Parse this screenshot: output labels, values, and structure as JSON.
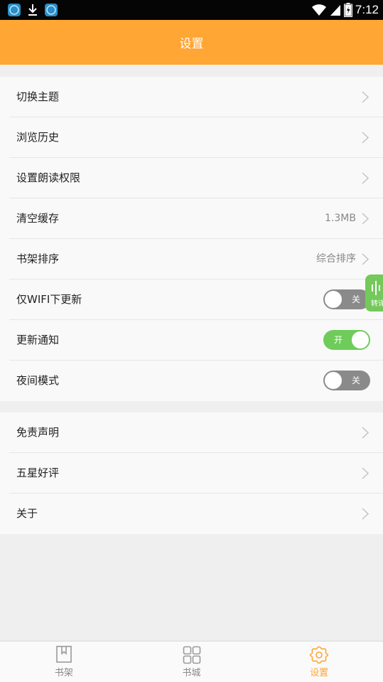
{
  "status_bar": {
    "time": "7:12"
  },
  "header": {
    "title": "设置"
  },
  "groups": [
    {
      "rows": [
        {
          "label": "切换主题",
          "value": ""
        },
        {
          "label": "浏览历史",
          "value": ""
        },
        {
          "label": "设置朗读权限",
          "value": ""
        },
        {
          "label": "清空缓存",
          "value": "1.3MB"
        },
        {
          "label": "书架排序",
          "value": "综合排序"
        },
        {
          "label": "仅WIFI下更新",
          "toggle": "关",
          "state": "off"
        },
        {
          "label": "更新通知",
          "toggle": "开",
          "state": "on"
        },
        {
          "label": "夜间模式",
          "toggle": "关",
          "state": "off"
        }
      ]
    },
    {
      "rows": [
        {
          "label": "免责声明"
        },
        {
          "label": "五星好评"
        },
        {
          "label": "关于"
        }
      ]
    }
  ],
  "float_badge": {
    "label": "转译"
  },
  "tabs": [
    {
      "label": "书架",
      "icon": "bookmark-icon",
      "active": false
    },
    {
      "label": "书城",
      "icon": "grid-icon",
      "active": false
    },
    {
      "label": "设置",
      "icon": "gear-icon",
      "active": true
    }
  ],
  "colors": {
    "accent": "#ffa634",
    "toggle_on": "#6fcc5a",
    "toggle_off": "#8a8a8a"
  }
}
